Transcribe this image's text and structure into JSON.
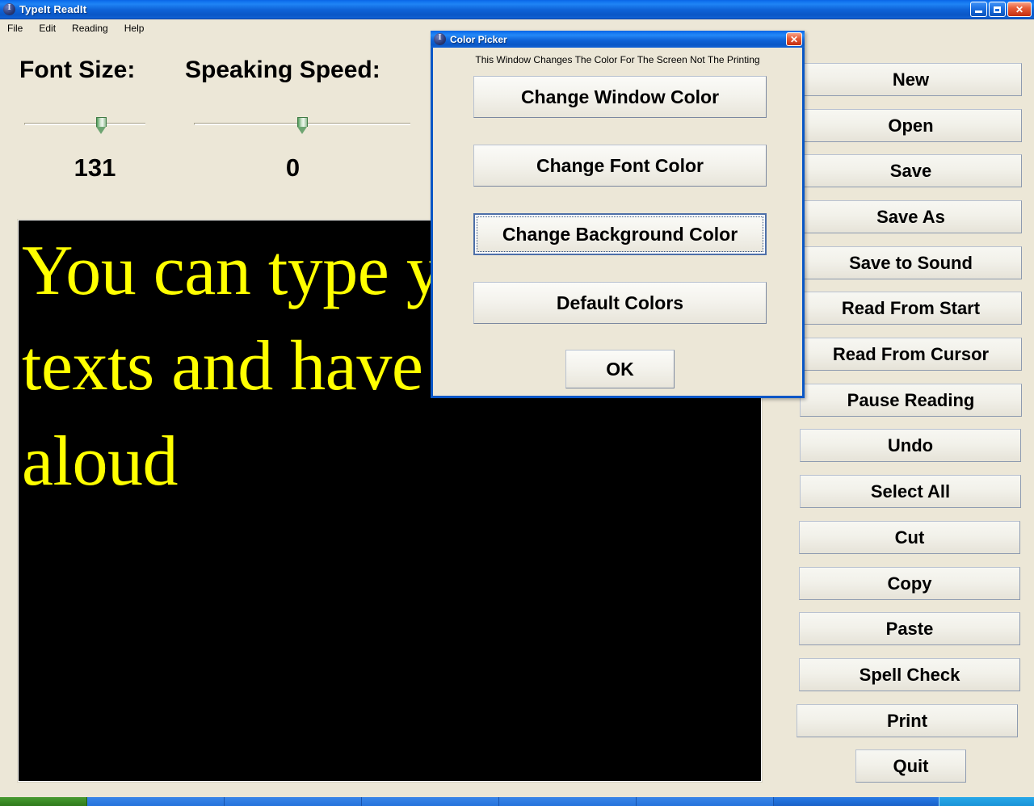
{
  "window": {
    "title": "TypeIt ReadIt",
    "icon": "app-icon",
    "controls": {
      "minimize": "minimize-icon",
      "restore": "restore-icon",
      "close": "✕"
    }
  },
  "menu": {
    "items": [
      {
        "label": "File"
      },
      {
        "label": "Edit"
      },
      {
        "label": "Reading"
      },
      {
        "label": "Help"
      }
    ]
  },
  "controls": {
    "font_size": {
      "label": "Font Size:",
      "value": "131"
    },
    "speaking_speed": {
      "label": "Speaking Speed:",
      "value": "0"
    }
  },
  "editor": {
    "text": "You can type your own texts and have them read aloud",
    "background_color": "#000000",
    "font_color": "#ffff00"
  },
  "side_buttons": [
    {
      "label": "New"
    },
    {
      "label": "Open"
    },
    {
      "label": "Save"
    },
    {
      "label": "Save As"
    },
    {
      "label": "Save to Sound"
    },
    {
      "label": "Read From Start"
    },
    {
      "label": "Read From Cursor"
    },
    {
      "label": "Pause Reading"
    },
    {
      "label": "Undo"
    },
    {
      "label": "Select All"
    },
    {
      "label": "Cut"
    },
    {
      "label": "Copy"
    },
    {
      "label": "Paste"
    },
    {
      "label": "Spell Check"
    },
    {
      "label": "Print"
    },
    {
      "label": "Quit"
    }
  ],
  "dialog": {
    "title": "Color Picker",
    "icon": "app-icon",
    "close_label": "✕",
    "note": "This Window Changes The Color For The Screen Not The Printing",
    "buttons": [
      {
        "label": "Change Window Color"
      },
      {
        "label": "Change Font Color"
      },
      {
        "label": "Change Background Color"
      },
      {
        "label": "Default Colors"
      }
    ],
    "ok_label": "OK",
    "focused_button": "Change Background Color"
  },
  "theme": {
    "window_bg": "#ece7d7",
    "titlebar_blue": "#0a57c6",
    "accent_green": "#4a9a33"
  }
}
